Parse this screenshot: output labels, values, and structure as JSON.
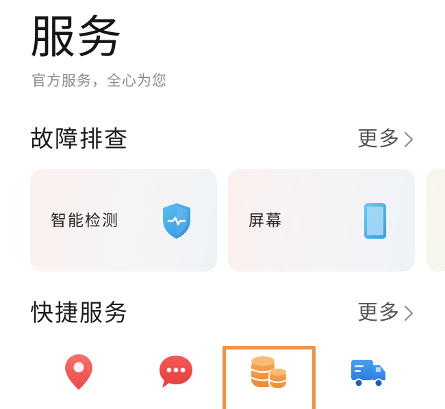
{
  "header": {
    "title": "服务",
    "subtitle": "官方服务，全心为您"
  },
  "troubleshoot": {
    "title": "故障排查",
    "more_label": "更多",
    "cards": [
      {
        "label": "智能检测",
        "icon": "shield-check-icon"
      },
      {
        "label": "屏幕",
        "icon": "phone-screen-icon"
      }
    ]
  },
  "quick_services": {
    "title": "快捷服务",
    "more_label": "更多",
    "items": [
      {
        "icon": "location-pin-icon"
      },
      {
        "icon": "chat-bubble-icon"
      },
      {
        "icon": "coins-icon"
      },
      {
        "icon": "delivery-truck-icon"
      }
    ]
  },
  "colors": {
    "accent_orange": "#f0924a",
    "shield_blue": "#3aa0e2",
    "pin_red": "#f1605e",
    "chat_red": "#ef4a48",
    "truck_blue": "#2f86e6"
  }
}
